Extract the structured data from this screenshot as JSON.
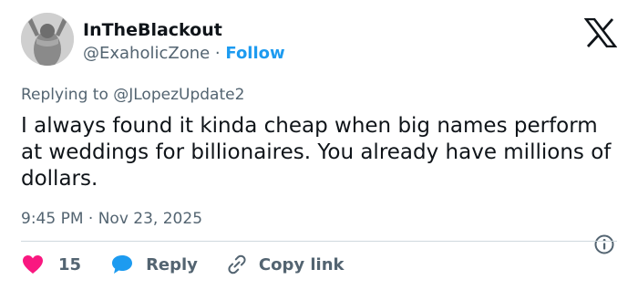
{
  "author": {
    "display_name": "InTheBlackout",
    "handle": "@ExaholicZone",
    "separator": " · ",
    "follow_label": "Follow"
  },
  "brand": {
    "logo_icon": "x-logo-icon"
  },
  "reply_context": {
    "prefix": "Replying to ",
    "mention": "@JLopezUpdate2"
  },
  "tweet": {
    "text": "I always found it kinda cheap when big names perform at weddings for billionaires. You already have millions of dollars.",
    "time": "9:45 PM",
    "date_separator": " · ",
    "date": "Nov 23, 2025"
  },
  "actions": {
    "like_icon": "heart-icon",
    "like_count": "15",
    "reply_icon": "speech-bubble-icon",
    "reply_label": "Reply",
    "copy_icon": "link-icon",
    "copy_label": "Copy link"
  },
  "colors": {
    "accent": "#1d9bf0",
    "like": "#f91880",
    "secondary_text": "#536471",
    "primary_text": "#0f1419",
    "divider": "#cfd9de"
  }
}
